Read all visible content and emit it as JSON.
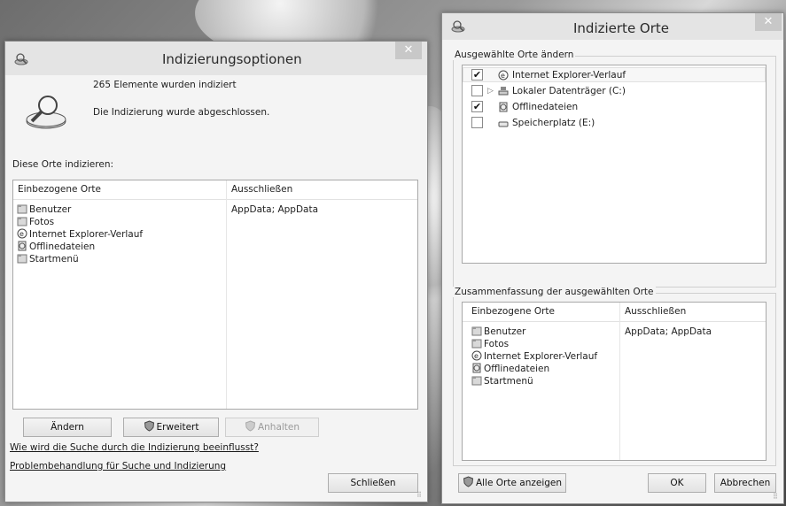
{
  "left_window": {
    "title": "Indizierungsoptionen",
    "status_count": "265 Elemente wurden indiziert",
    "status_message": "Die Indizierung wurde abgeschlossen.",
    "section_label": "Diese Orte indizieren:",
    "columns": [
      "Einbezogene Orte",
      "Ausschließen"
    ],
    "rows": [
      {
        "name": "Benutzer",
        "icon": "folder-icon",
        "exclude": "AppData; AppData"
      },
      {
        "name": "Fotos",
        "icon": "folder-icon",
        "exclude": ""
      },
      {
        "name": "Internet Explorer-Verlauf",
        "icon": "ie-icon",
        "exclude": ""
      },
      {
        "name": "Offlinedateien",
        "icon": "offline-files-icon",
        "exclude": ""
      },
      {
        "name": "Startmenü",
        "icon": "folder-icon",
        "exclude": ""
      }
    ],
    "buttons": {
      "change": "Ändern",
      "advanced": "Erweitert",
      "pause": "Anhalten",
      "close": "Schließen"
    },
    "links": {
      "search_impact": "Wie wird die Suche durch die Indizierung beeinflusst?",
      "troubleshoot": "Problembehandlung für Suche und Indizierung"
    }
  },
  "right_window": {
    "title": "Indizierte Orte",
    "change_group_label": "Ausgewählte Orte ändern",
    "tree": [
      {
        "label": "Internet Explorer-Verlauf",
        "checked": true,
        "expandable": false,
        "icon": "ie-icon"
      },
      {
        "label": "Lokaler Datenträger (C:)",
        "checked": false,
        "expandable": true,
        "icon": "drive-icon"
      },
      {
        "label": "Offlinedateien",
        "checked": true,
        "expandable": false,
        "icon": "offline-files-icon"
      },
      {
        "label": "Speicherplatz (E:)",
        "checked": false,
        "expandable": false,
        "icon": "drive-icon"
      }
    ],
    "summary_group_label": "Zusammenfassung der ausgewählten Orte",
    "columns": [
      "Einbezogene Orte",
      "Ausschließen"
    ],
    "rows": [
      {
        "name": "Benutzer",
        "icon": "folder-icon",
        "exclude": "AppData; AppData"
      },
      {
        "name": "Fotos",
        "icon": "folder-icon",
        "exclude": ""
      },
      {
        "name": "Internet Explorer-Verlauf",
        "icon": "ie-icon",
        "exclude": ""
      },
      {
        "name": "Offlinedateien",
        "icon": "offline-files-icon",
        "exclude": ""
      },
      {
        "name": "Startmenü",
        "icon": "folder-icon",
        "exclude": ""
      }
    ],
    "buttons": {
      "show_all": "Alle Orte anzeigen",
      "ok": "OK",
      "cancel": "Abbrechen"
    }
  },
  "check_mark": "✔",
  "close_glyph": "✕",
  "expand_glyph": "▷"
}
